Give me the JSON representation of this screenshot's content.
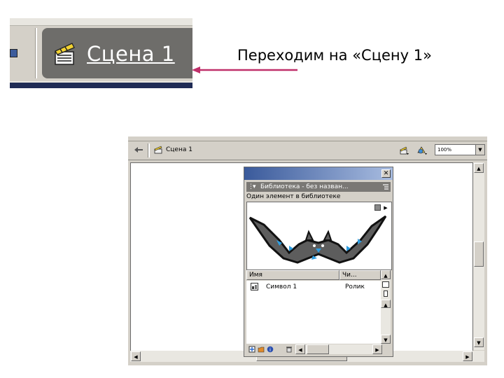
{
  "caption": "Переходим на «Сцену 1»",
  "zoomed_bar": {
    "scene_label": "Сцена 1",
    "icons": [
      "timeline-icon",
      "scene-clapper-icon"
    ]
  },
  "flash": {
    "edit_bar": {
      "scene_label": "Сцена 1",
      "zoom_value": "100%",
      "icons": [
        "back-arrow-icon",
        "scene-clapper-icon",
        "edit-symbols-icon",
        "edit-scene-icon"
      ]
    },
    "library": {
      "title": "Библиотека - без назван...",
      "info": "Один элемент в библиотеке",
      "columns": [
        "Имя",
        "Чи..."
      ],
      "items": [
        {
          "name": "Символ 1",
          "type": "Ролик",
          "icon": "movie-clip-icon"
        }
      ]
    }
  },
  "colors": {
    "arrow": "#c0306a",
    "scene_tab": "#6e6d6a",
    "bat_body": "#5d5d5d",
    "bat_accent": "#2e9de0"
  }
}
